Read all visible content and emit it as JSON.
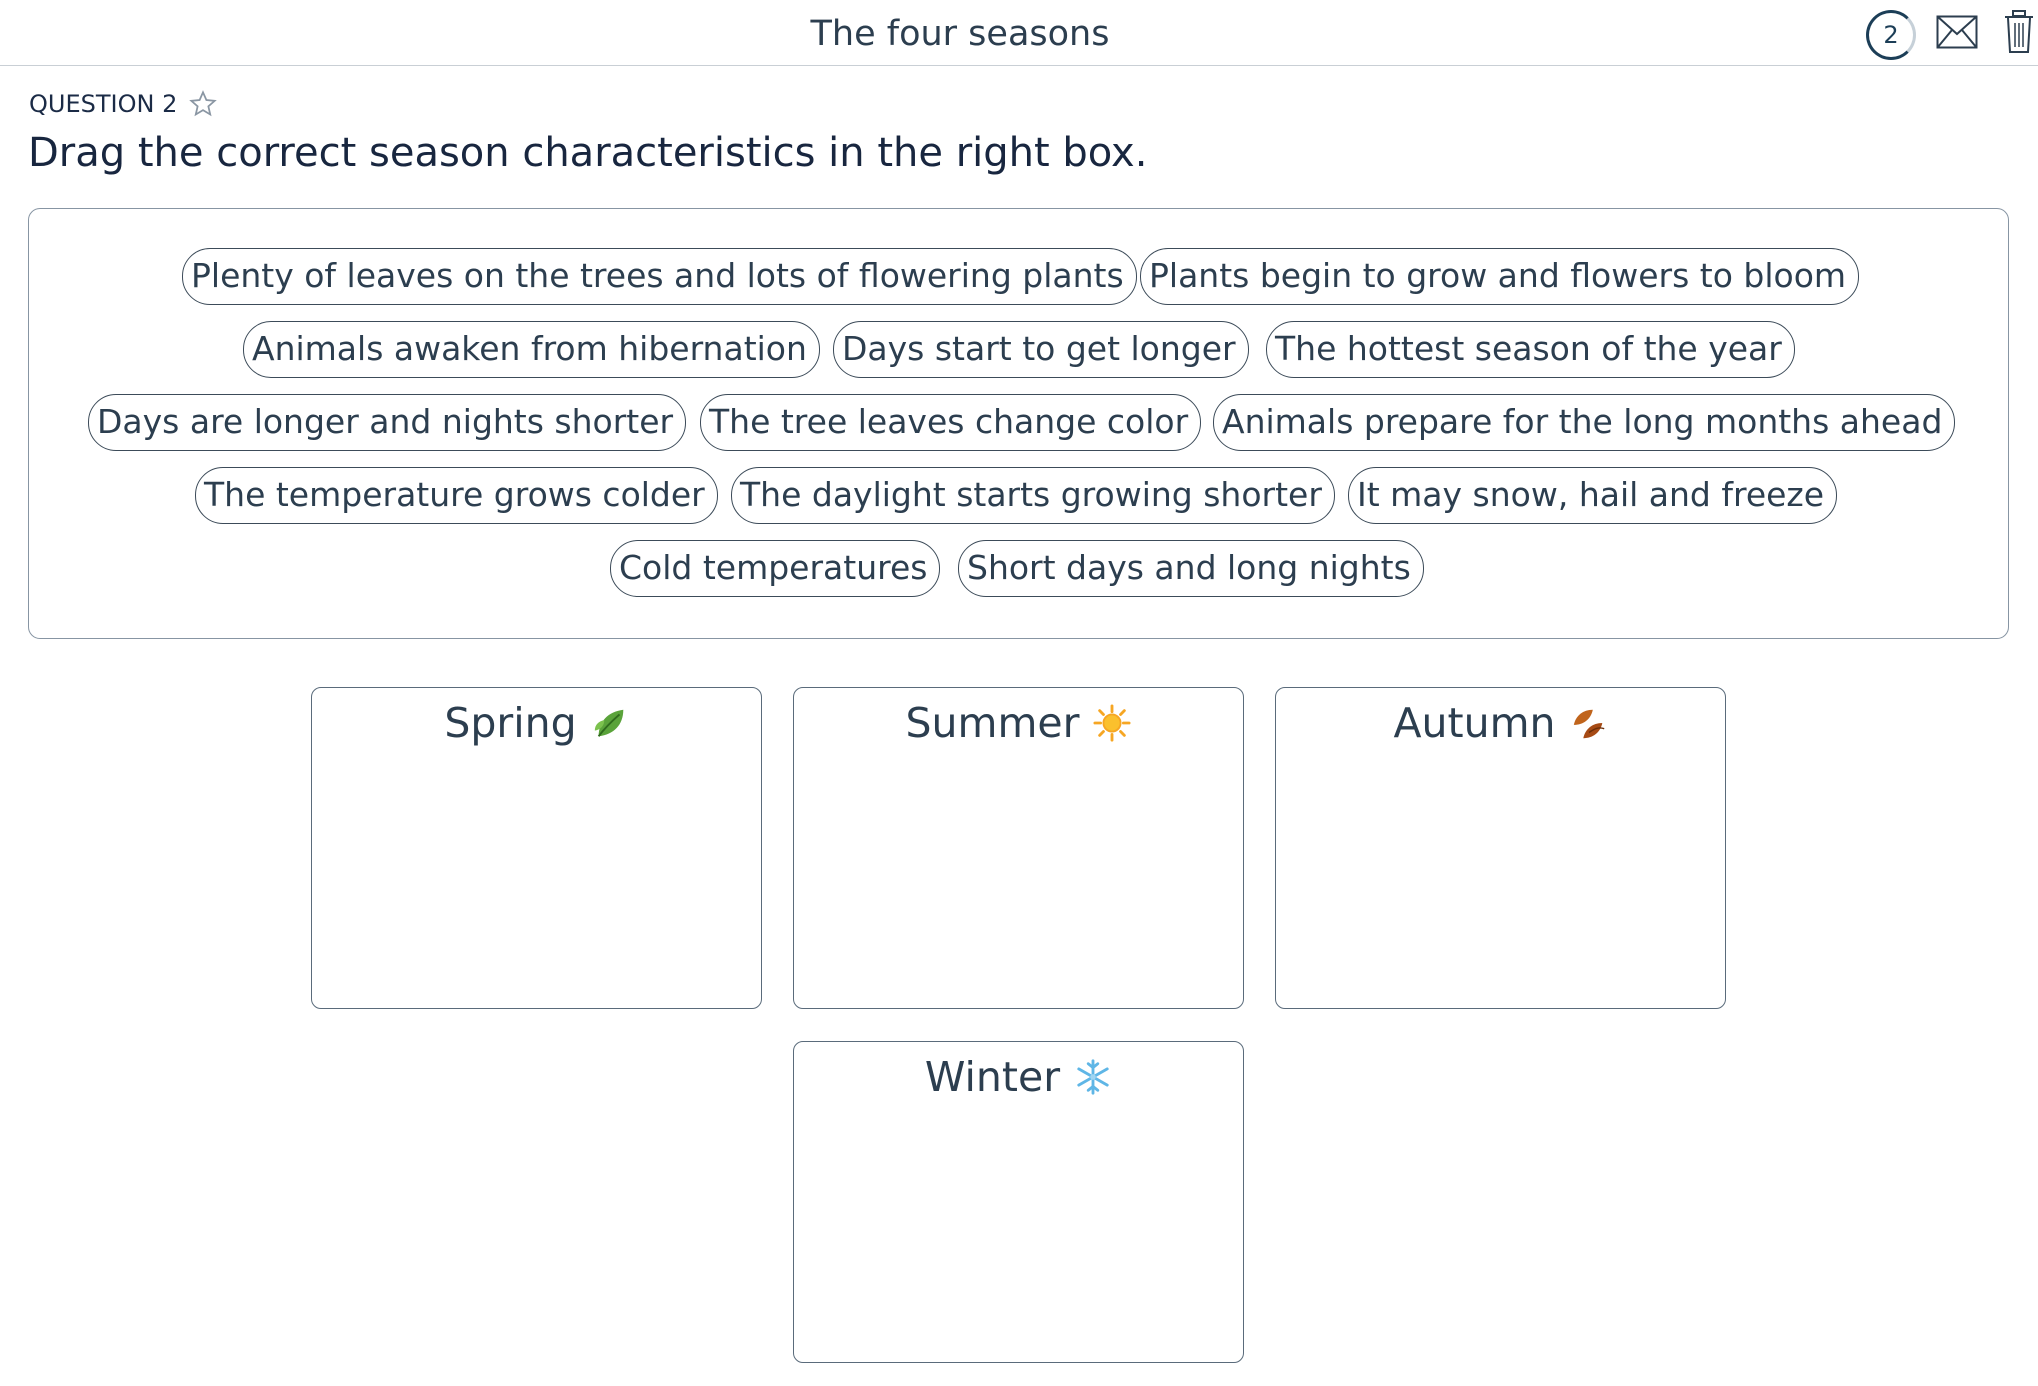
{
  "header": {
    "title": "The four seasons",
    "counter": "2",
    "mail_icon": "mail-icon",
    "trash_icon": "trash-icon"
  },
  "question": {
    "label": "QUESTION 2",
    "star_icon": "star-outline-icon",
    "instruction": "Drag the correct season characteristics in the right box."
  },
  "chips": [
    "Plenty of leaves on the trees and lots of flowering plants",
    "Plants begin to grow and flowers to bloom",
    "Animals awaken from hibernation",
    "Days start to get longer",
    "The hottest season of the year",
    "Days are longer and nights shorter",
    "The tree leaves change color",
    "Animals prepare for the long months ahead",
    "The temperature grows colder",
    "The daylight starts growing shorter",
    "It may snow, hail and freeze",
    "Cold temperatures",
    "Short days and long nights"
  ],
  "zones": [
    {
      "label": "Spring",
      "icon": "leaf-icon"
    },
    {
      "label": "Summer",
      "icon": "sun-icon"
    },
    {
      "label": "Autumn",
      "icon": "fallen-leaves-icon"
    },
    {
      "label": "Winter",
      "icon": "snowflake-icon"
    }
  ],
  "colors": {
    "text": "#2c3e4f",
    "heading": "#18263f",
    "border": "#3c4b59",
    "accent": "#1c3e57"
  }
}
